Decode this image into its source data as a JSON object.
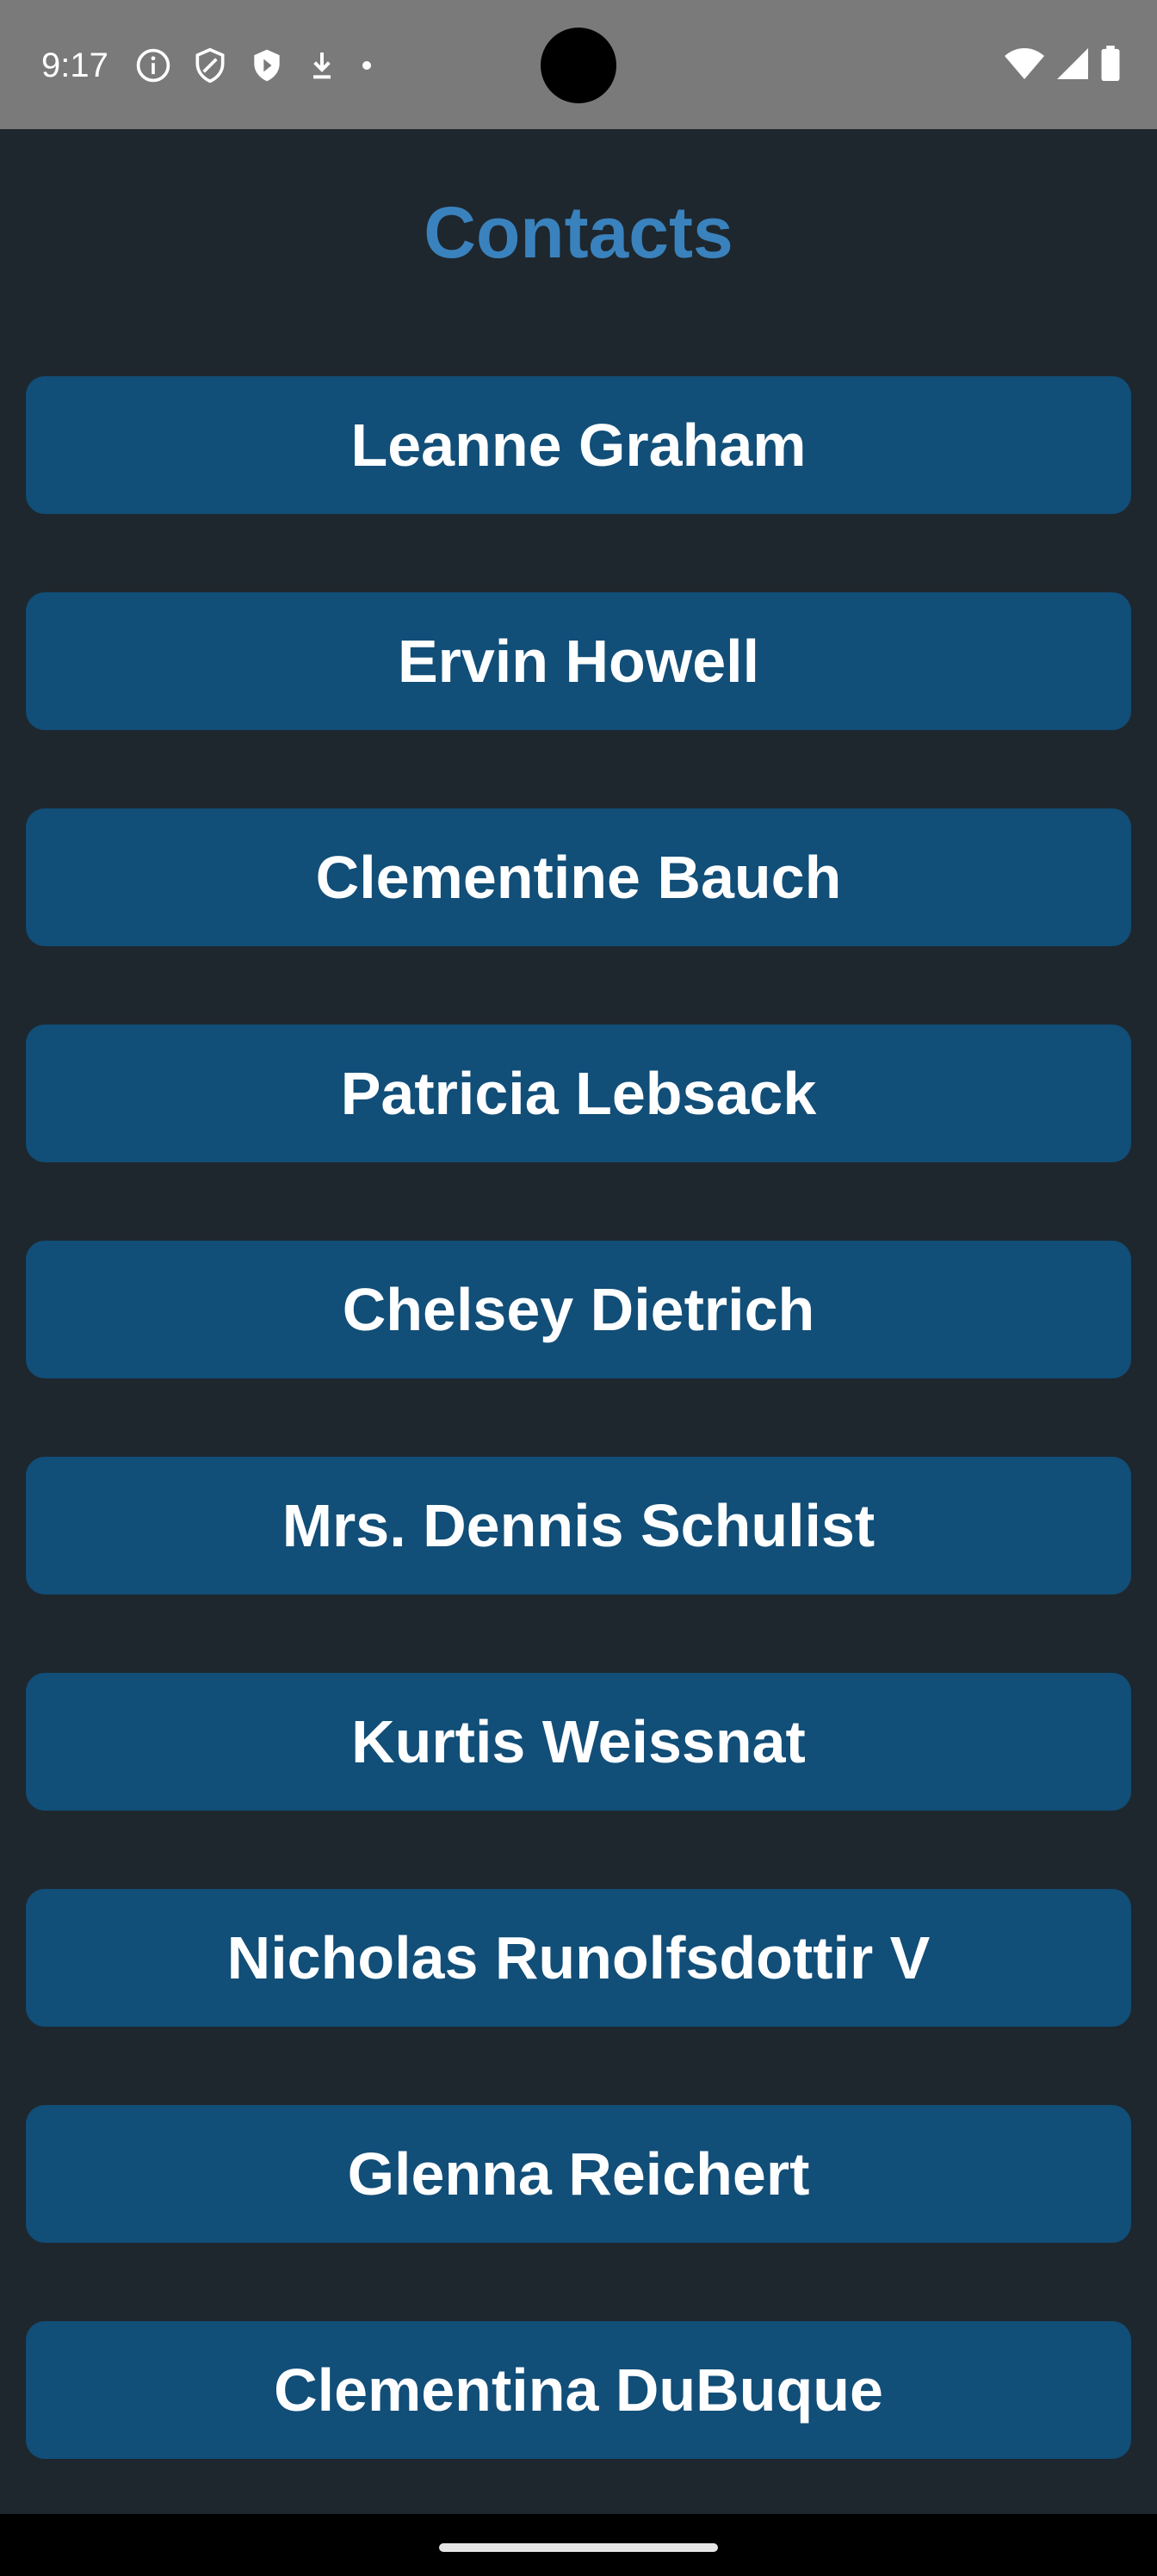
{
  "status_bar": {
    "time": "9:17",
    "left_icons": [
      "info-icon",
      "shield-outline-icon",
      "shield-filled-icon",
      "download-icon",
      "dot-icon"
    ],
    "right_icons": [
      "wifi-icon",
      "cellular-signal-icon",
      "battery-icon"
    ]
  },
  "app": {
    "title": "Contacts",
    "title_color": "#3a82bd",
    "button_color": "#114e78",
    "background_color": "#1e272e"
  },
  "contacts": [
    {
      "name": "Leanne Graham"
    },
    {
      "name": "Ervin Howell"
    },
    {
      "name": "Clementine Bauch"
    },
    {
      "name": "Patricia Lebsack"
    },
    {
      "name": "Chelsey Dietrich"
    },
    {
      "name": "Mrs. Dennis Schulist"
    },
    {
      "name": "Kurtis Weissnat"
    },
    {
      "name": "Nicholas Runolfsdottir V"
    },
    {
      "name": "Glenna Reichert"
    },
    {
      "name": "Clementina DuBuque"
    }
  ]
}
